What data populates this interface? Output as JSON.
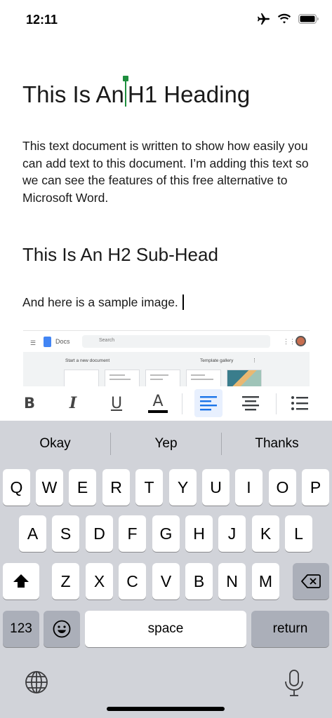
{
  "status_bar": {
    "time": "12:11",
    "icons": [
      "airplane-icon",
      "wifi-icon",
      "battery-icon"
    ]
  },
  "document": {
    "h1_before_cursor": "This Is An",
    "h1_after_cursor": "H1 Heading",
    "paragraph1": "This text document is written to show how easily you can add text to this document. I’m adding this text so we can see the features of this free alternative to Microsoft Word.",
    "h2": "This Is An H2 Sub-Head",
    "paragraph2": "And here is a sample image.",
    "sample_image": {
      "app_label": "Docs",
      "search_placeholder": "Search",
      "start_new": "Start a new document",
      "template_gallery": "Template gallery"
    },
    "cursor_color": "#1e8e3e"
  },
  "format_toolbar": {
    "bold": "B",
    "italic": "I",
    "underline": "U",
    "text_color": "A",
    "active_button": "align-left",
    "accent_color": "#1a73e8"
  },
  "keyboard": {
    "suggestions": [
      "Okay",
      "Yep",
      "Thanks"
    ],
    "row1": [
      "Q",
      "W",
      "E",
      "R",
      "T",
      "Y",
      "U",
      "I",
      "O",
      "P"
    ],
    "row2": [
      "A",
      "S",
      "D",
      "F",
      "G",
      "H",
      "J",
      "K",
      "L"
    ],
    "row3": [
      "Z",
      "X",
      "C",
      "V",
      "B",
      "N",
      "M"
    ],
    "numbers_label": "123",
    "space_label": "space",
    "return_label": "return"
  }
}
